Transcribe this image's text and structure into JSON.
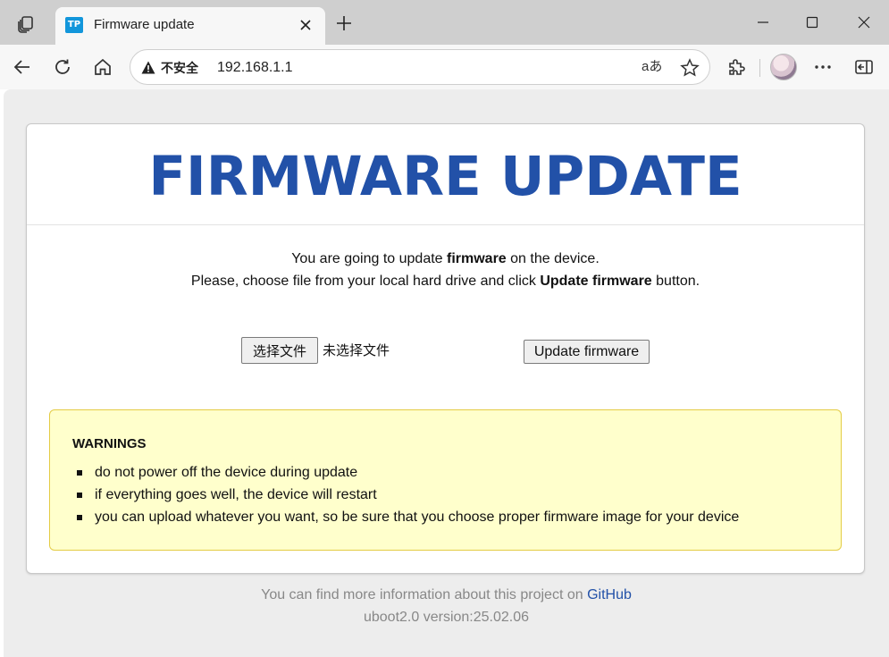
{
  "browser": {
    "tab": {
      "favicon_text": "TP",
      "title": "Firmware update"
    },
    "address": {
      "security_label": "不安全",
      "url": "192.168.1.1",
      "read_aloud": "aあ"
    }
  },
  "page": {
    "title": "FIRMWARE UPDATE",
    "intro_line1": {
      "before": "You are going to update ",
      "bold": "firmware",
      "after": " on the device."
    },
    "intro_line2": {
      "before": "Please, choose file from your local hard drive and click ",
      "bold": "Update firmware",
      "after": " button."
    },
    "file_input": {
      "button_label": "选择文件",
      "status": "未选择文件"
    },
    "update_button": "Update firmware",
    "warnings": {
      "title": "WARNINGS",
      "items": [
        "do not power off the device during update",
        "if everything goes well, the device will restart",
        "you can upload whatever you want, so be sure that you choose proper firmware image for your device"
      ]
    },
    "footer": {
      "info_text": "You can find more information about this project on ",
      "link_text": "GitHub",
      "version": "uboot2.0 version:25.02.06"
    }
  },
  "colors": {
    "title": "#2251a8",
    "warning_bg": "#ffffcc",
    "warning_border": "#e4cc44",
    "link": "#2251a8",
    "favicon": "#1296db"
  }
}
